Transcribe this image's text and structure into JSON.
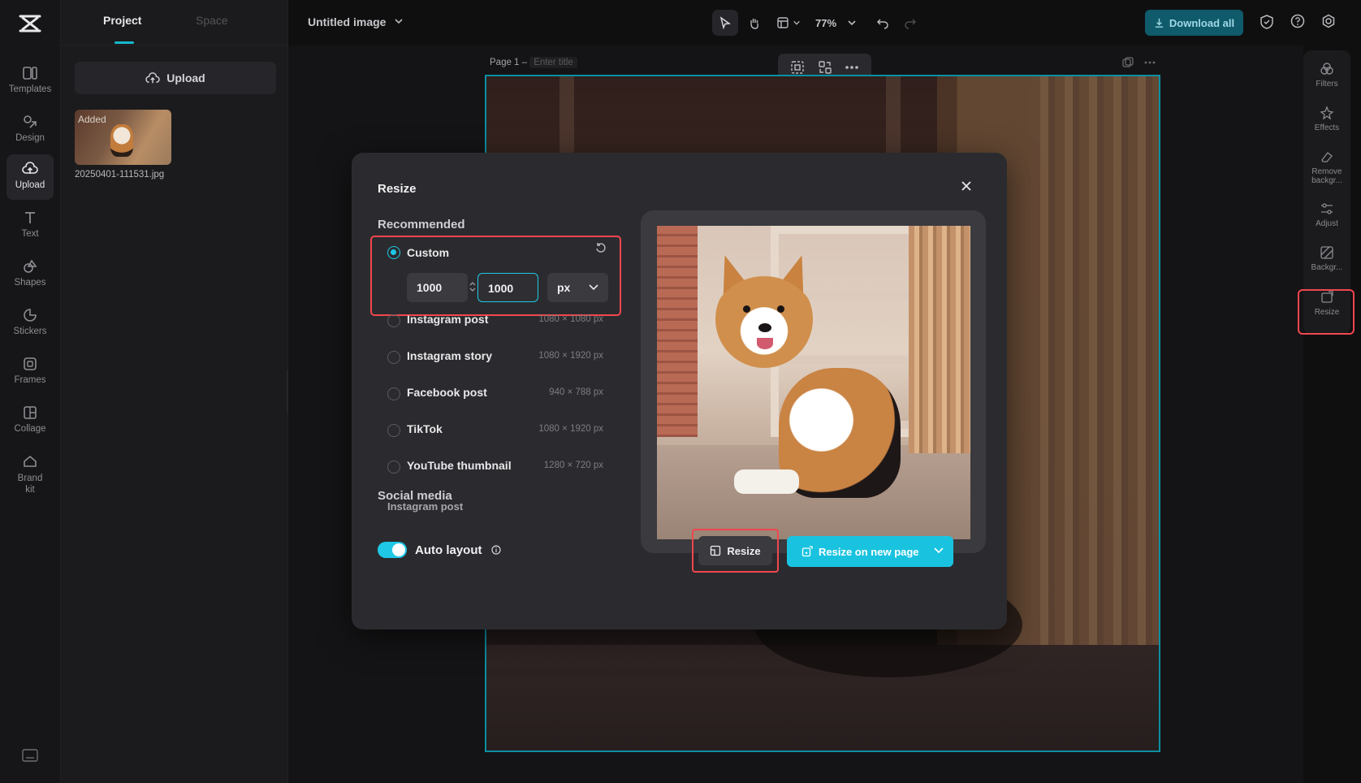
{
  "left_rail": {
    "items": [
      {
        "label": "Templates"
      },
      {
        "label": "Design"
      },
      {
        "label": "Upload"
      },
      {
        "label": "Text"
      },
      {
        "label": "Shapes"
      },
      {
        "label": "Stickers"
      },
      {
        "label": "Frames"
      },
      {
        "label": "Collage"
      },
      {
        "label": "Brand kit"
      }
    ]
  },
  "panel": {
    "tabs": [
      {
        "label": "Project"
      },
      {
        "label": "Space"
      }
    ],
    "upload_label": "Upload",
    "asset": {
      "badge": "Added",
      "filename": "20250401-111531.jpg"
    }
  },
  "topbar": {
    "title": "Untitled image",
    "zoom": "77%",
    "download_label": "Download all"
  },
  "canvas": {
    "page_label": "Page 1 –",
    "title_placeholder": "Enter title"
  },
  "right_rail": {
    "items": [
      {
        "label": "Filters"
      },
      {
        "label": "Effects"
      },
      {
        "label": "Remove backgr..."
      },
      {
        "label": "Adjust"
      },
      {
        "label": "Backgr..."
      },
      {
        "label": "Resize"
      }
    ]
  },
  "modal": {
    "title": "Resize",
    "recommended_label": "Recommended",
    "custom": {
      "label": "Custom",
      "width": "1000",
      "height": "1000",
      "unit": "px"
    },
    "options": [
      {
        "label": "Instagram post",
        "size": "1080 × 1080 px"
      },
      {
        "label": "Instagram story",
        "size": "1080 × 1920 px"
      },
      {
        "label": "Facebook post",
        "size": "940 × 788 px"
      },
      {
        "label": "TikTok",
        "size": "1080 × 1920 px"
      },
      {
        "label": "YouTube thumbnail",
        "size": "1280 × 720 px"
      }
    ],
    "social_label": "Social media",
    "social_items": [
      {
        "label": "Instagram post"
      }
    ],
    "auto_layout_label": "Auto layout",
    "auto_layout_on": true,
    "resize_label": "Resize",
    "resize_new_label": "Resize on new page"
  },
  "colors": {
    "accent": "#19c3e0",
    "highlight": "#f2464e",
    "download_bg": "#0f5a6b"
  }
}
